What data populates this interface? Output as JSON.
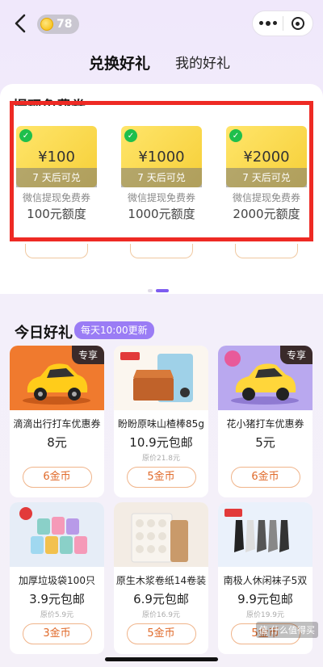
{
  "header": {
    "coin_count": "78"
  },
  "tabs": [
    {
      "label": "兑换好礼"
    },
    {
      "label": "我的好礼"
    }
  ],
  "panel": {
    "title": "提现免费券"
  },
  "coupons": [
    {
      "amount": "¥100",
      "condition": "7 天后可兑",
      "name": "微信提现免费券",
      "quota": "100元额度"
    },
    {
      "amount": "¥1000",
      "condition": "7 天后可兑",
      "name": "微信提现免费券",
      "quota": "1000元额度"
    },
    {
      "amount": "¥2000",
      "condition": "7 天后可兑",
      "name": "微信提现免费券",
      "quota": "2000元额度"
    }
  ],
  "pager": {
    "active_index": 1,
    "count": 2
  },
  "section": {
    "title": "今日好礼",
    "badge": "每天10:00更新"
  },
  "products": [
    {
      "title": "滴滴出行打车优惠券",
      "price": "8元",
      "original": "",
      "cost": "6金币",
      "tag": "专享"
    },
    {
      "title": "盼盼原味山楂棒85g",
      "price": "10.9元包邮",
      "original": "原价21.8元",
      "cost": "5金币",
      "tag": ""
    },
    {
      "title": "花小猪打车优惠券",
      "price": "5元",
      "original": "",
      "cost": "6金币",
      "tag": "专享"
    },
    {
      "title": "加厚垃圾袋100只",
      "price": "3.9元包邮",
      "original": "原价5.9元",
      "cost": "3金币",
      "tag": ""
    },
    {
      "title": "原生木浆卷纸14卷装",
      "price": "6.9元包邮",
      "original": "原价16.9元",
      "cost": "5金币",
      "tag": ""
    },
    {
      "title": "南极人休闲袜子5双",
      "price": "9.9元包邮",
      "original": "原价19.9元",
      "cost": "5金币",
      "tag": ""
    }
  ],
  "watermark": "值 什么值得买",
  "colors": {
    "accent_purple": "#7d5cf0",
    "highlight_red": "#ee2a24",
    "coupon_yellow": "#f6cf38",
    "button_orange": "#e06a2a"
  }
}
